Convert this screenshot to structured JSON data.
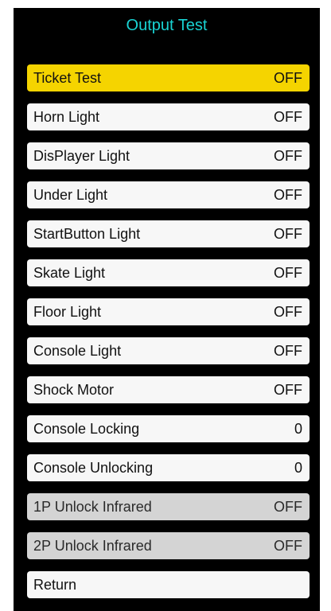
{
  "title": "Output Test",
  "colors": {
    "background": "#000000",
    "title": "#19d3d3",
    "item": "#f7f7f7",
    "selected": "#f5d400",
    "disabled": "#d4d4d4"
  },
  "items": [
    {
      "label": "Ticket Test",
      "value": "OFF",
      "state": "selected"
    },
    {
      "label": "Horn Light",
      "value": "OFF",
      "state": "normal"
    },
    {
      "label": "DisPlayer Light",
      "value": "OFF",
      "state": "normal"
    },
    {
      "label": "Under Light",
      "value": "OFF",
      "state": "normal"
    },
    {
      "label": "StartButton Light",
      "value": "OFF",
      "state": "normal"
    },
    {
      "label": "Skate Light",
      "value": "OFF",
      "state": "normal"
    },
    {
      "label": "Floor Light",
      "value": "OFF",
      "state": "normal"
    },
    {
      "label": "Console Light",
      "value": "OFF",
      "state": "normal"
    },
    {
      "label": "Shock Motor",
      "value": "OFF",
      "state": "normal"
    },
    {
      "label": "Console Locking",
      "value": "0",
      "state": "normal"
    },
    {
      "label": "Console Unlocking",
      "value": "0",
      "state": "normal"
    },
    {
      "label": "1P Unlock Infrared",
      "value": "OFF",
      "state": "disabled"
    },
    {
      "label": "2P Unlock Infrared",
      "value": "OFF",
      "state": "disabled"
    },
    {
      "label": "Return",
      "value": "",
      "state": "normal"
    }
  ]
}
